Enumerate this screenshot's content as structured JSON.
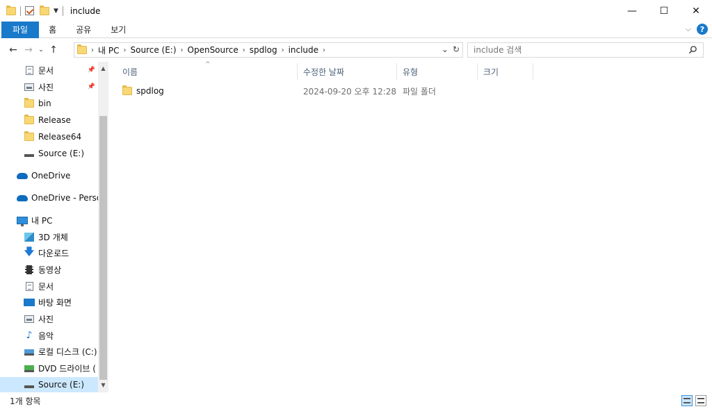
{
  "window": {
    "title": "include",
    "controls": {
      "minimize": "—",
      "maximize": "☐",
      "close": "✕"
    }
  },
  "ribbon": {
    "tabs": [
      "파일",
      "홈",
      "공유",
      "보기"
    ],
    "help": "?"
  },
  "address": {
    "breadcrumbs": [
      "내 PC",
      "Source (E:)",
      "OpenSource",
      "spdlog",
      "include"
    ]
  },
  "search": {
    "placeholder": "include 검색"
  },
  "nav": {
    "items": [
      {
        "label": "문서",
        "icon": "document-icon",
        "pinned": true
      },
      {
        "label": "사진",
        "icon": "pictures-icon",
        "pinned": true
      },
      {
        "label": "bin",
        "icon": "folder-icon"
      },
      {
        "label": "Release",
        "icon": "folder-icon"
      },
      {
        "label": "Release64",
        "icon": "folder-icon"
      },
      {
        "label": "Source (E:)",
        "icon": "drive-icon"
      },
      {
        "label": "OneDrive",
        "icon": "cloud-icon"
      },
      {
        "label": "OneDrive - Persor",
        "icon": "cloud-icon"
      },
      {
        "label": "내 PC",
        "icon": "pc-icon"
      },
      {
        "label": "3D 개체",
        "icon": "3d-objects-icon"
      },
      {
        "label": "다운로드",
        "icon": "download-icon"
      },
      {
        "label": "동영상",
        "icon": "video-icon"
      },
      {
        "label": "문서",
        "icon": "document-icon"
      },
      {
        "label": "바탕 화면",
        "icon": "desktop-icon"
      },
      {
        "label": "사진",
        "icon": "pictures-icon"
      },
      {
        "label": "음악",
        "icon": "music-icon"
      },
      {
        "label": "로컬 디스크 (C:)",
        "icon": "local-disk-icon"
      },
      {
        "label": "DVD 드라이브 (",
        "icon": "dvd-drive-icon"
      },
      {
        "label": "Source (E:)",
        "icon": "drive-icon",
        "selected": true
      }
    ]
  },
  "columns": [
    "이름",
    "수정한 날짜",
    "유형",
    "크기"
  ],
  "files": [
    {
      "name": "spdlog",
      "modified": "2024-09-20 오후 12:28",
      "type": "파일 폴더",
      "size": ""
    }
  ],
  "status": {
    "item_count": "1개 항목"
  }
}
